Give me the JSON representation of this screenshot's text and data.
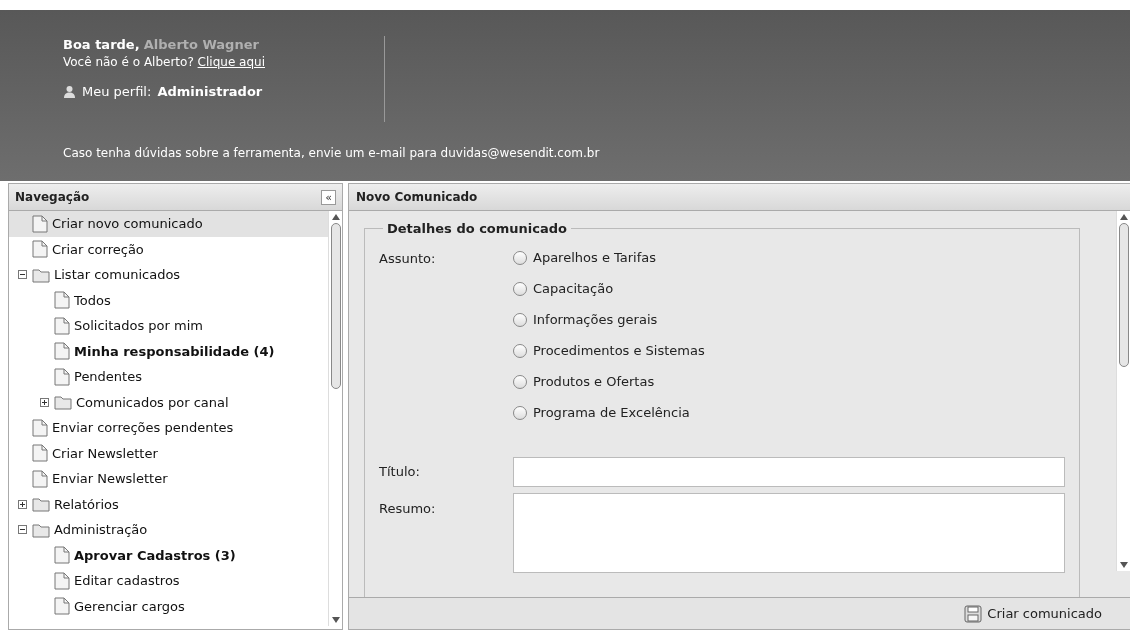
{
  "header": {
    "greeting": "Boa tarde,",
    "user_name": "Alberto Wagner",
    "not_you": "Você não é o Alberto?",
    "not_you_link": "Clique aqui",
    "profile_label": "Meu perfil:",
    "profile_value": "Administrador",
    "help_text": "Caso tenha dúvidas sobre a ferramenta, envie um e-mail para duvidas@wesendit.com.br"
  },
  "sidebar": {
    "title": "Navegação",
    "collapse": "«",
    "items": [
      {
        "label": "Criar novo comunicado",
        "selected": true,
        "bold": false
      },
      {
        "label": "Criar correção",
        "selected": false,
        "bold": false
      },
      {
        "label": "Listar comunicados",
        "selected": false,
        "bold": false,
        "expanded": true,
        "children": [
          {
            "label": "Todos",
            "selected": false,
            "bold": false
          },
          {
            "label": "Solicitados por mim",
            "selected": false,
            "bold": false
          },
          {
            "label": "Minha responsabilidade (4)",
            "selected": false,
            "bold": true
          },
          {
            "label": "Pendentes",
            "selected": false,
            "bold": false
          },
          {
            "label": "Comunicados por canal",
            "selected": false,
            "bold": false,
            "expanded": false
          }
        ]
      },
      {
        "label": "Enviar correções pendentes",
        "selected": false,
        "bold": false
      },
      {
        "label": "Criar Newsletter",
        "selected": false,
        "bold": false
      },
      {
        "label": "Enviar Newsletter",
        "selected": false,
        "bold": false
      },
      {
        "label": "Relatórios",
        "selected": false,
        "bold": false,
        "expanded": false
      },
      {
        "label": "Administração",
        "selected": false,
        "bold": false,
        "expanded": true,
        "children": [
          {
            "label": "Aprovar Cadastros (3)",
            "selected": false,
            "bold": true
          },
          {
            "label": "Editar cadastros",
            "selected": false,
            "bold": false
          },
          {
            "label": "Gerenciar cargos",
            "selected": false,
            "bold": false
          }
        ]
      }
    ]
  },
  "panel": {
    "title": "Novo Comunicado",
    "fieldset": "Detalhes do comunicado",
    "subject_label": "Assunto:",
    "subjects": [
      {
        "label": "Aparelhos e Tarifas",
        "selected": false
      },
      {
        "label": "Capacitação",
        "selected": false
      },
      {
        "label": "Informações gerais",
        "selected": false
      },
      {
        "label": "Procedimentos e Sistemas",
        "selected": false
      },
      {
        "label": "Produtos e Ofertas",
        "selected": false
      },
      {
        "label": "Programa de Excelência",
        "selected": false
      }
    ],
    "title_label": "Título:",
    "summary_label": "Resumo:",
    "submit": "Criar comunicado"
  }
}
